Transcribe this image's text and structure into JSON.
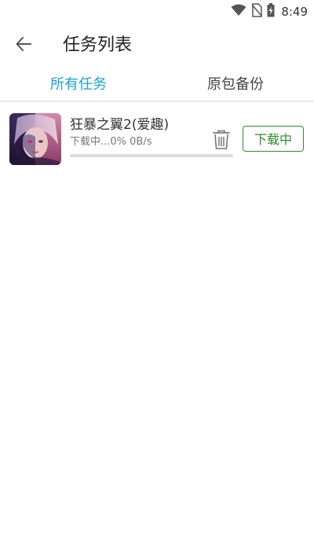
{
  "status_bar": {
    "time": "8:49",
    "icons": [
      "wifi-icon",
      "no-sim-icon",
      "battery-charging-icon"
    ]
  },
  "app_bar": {
    "back_icon": "arrow-left-icon",
    "title": "任务列表"
  },
  "tabs": [
    {
      "label": "所有任务",
      "active": true
    },
    {
      "label": "原包备份",
      "active": false
    }
  ],
  "tasks": [
    {
      "name": "狂暴之翼2(爱趣)",
      "status": "下载中...0% 0B/s",
      "progress": 0,
      "action_label": "下载中",
      "delete_icon": "trash-icon"
    }
  ],
  "colors": {
    "accent": "#1aa1d5",
    "progress": "#2e8b2e",
    "button": "#2e8b2e"
  }
}
